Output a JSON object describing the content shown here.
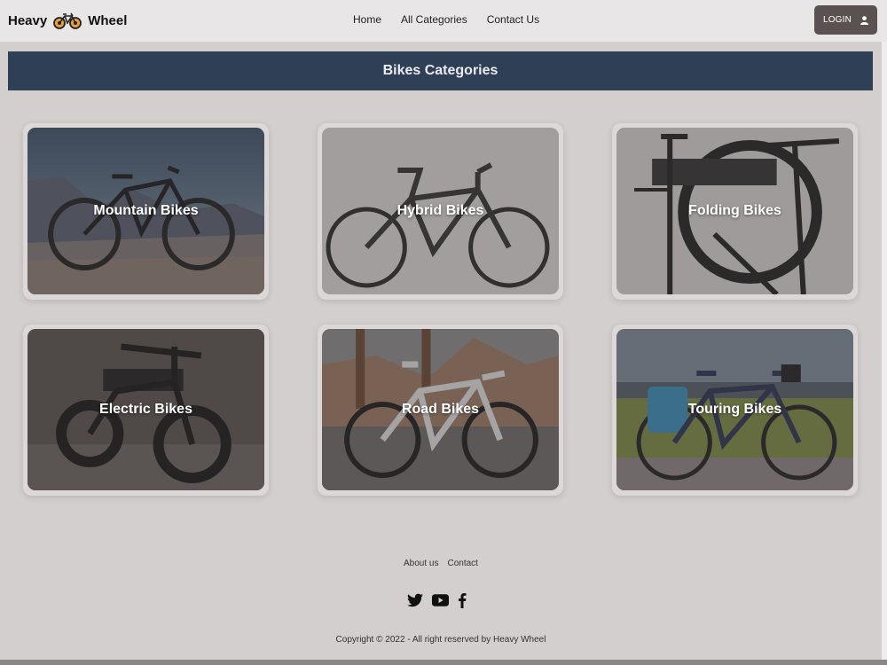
{
  "brand": {
    "name_left": "Heavy",
    "name_right": "Wheel",
    "logo_icon": "bicycle-icon"
  },
  "nav": {
    "links": [
      {
        "label": "Home"
      },
      {
        "label": "All Categories"
      },
      {
        "label": "Contact Us"
      }
    ],
    "login_label": "LOGIN",
    "login_icon": "user-icon"
  },
  "banner": {
    "title": "Bikes Categories"
  },
  "categories": [
    {
      "label": "Mountain Bikes"
    },
    {
      "label": "Hybrid Bikes"
    },
    {
      "label": "Folding Bikes"
    },
    {
      "label": "Electric Bikes"
    },
    {
      "label": "Road Bikes"
    },
    {
      "label": "Touring Bikes"
    }
  ],
  "footer": {
    "links": [
      {
        "label": "About us"
      },
      {
        "label": "Contact"
      }
    ],
    "social_icons": [
      "twitter-icon",
      "youtube-icon",
      "facebook-icon"
    ],
    "copyright": "Copyright © 2022 - All right reserved by Heavy Wheel"
  },
  "colors": {
    "banner": "#2e3f56",
    "page_bg": "#d3cfce",
    "navbar_bg": "#e8e6e6",
    "login_bg": "#595251"
  }
}
